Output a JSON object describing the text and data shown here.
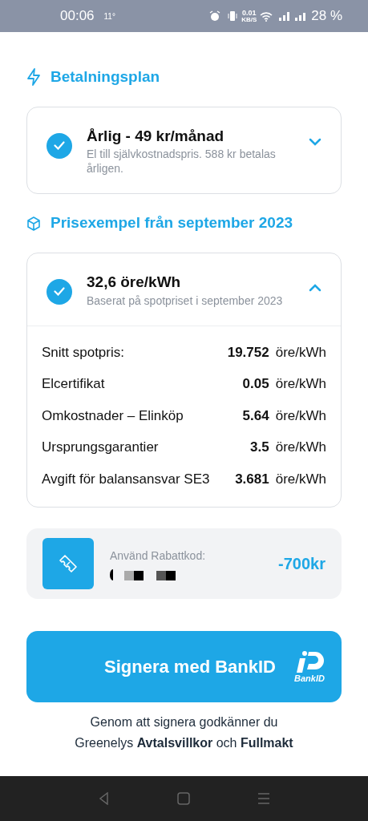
{
  "status_bar": {
    "time": "00:06",
    "temperature": "11°",
    "speed": "0.01",
    "speed_unit": "KB/S",
    "battery": "28 %"
  },
  "sections": [
    {
      "title": "Betalningsplan",
      "kind": "bolt",
      "card": {
        "title": "Årlig - 49 kr/månad",
        "subtitle": "El till självkostnadspris. 588 kr betalas årligen.",
        "checked": true,
        "expanded": false
      }
    },
    {
      "title": "Prisexempel från september 2023",
      "kind": "box",
      "card": {
        "title": "32,6 öre/kWh",
        "subtitle": "Baserat på spotpriset i september 2023",
        "checked": true,
        "expanded": true,
        "rows": [
          {
            "label": "Snitt spotpris:",
            "value": "19.752",
            "unit": "öre/kWh"
          },
          {
            "label": "Elcertifikat",
            "value": "0.05",
            "unit": "öre/kWh"
          },
          {
            "label": "Omkostnader – Elinköp",
            "value": "5.64",
            "unit": "öre/kWh"
          },
          {
            "label": "Ursprungsgarantier",
            "value": "3.5",
            "unit": "öre/kWh"
          },
          {
            "label": "Avgift för balansansvar SE3",
            "value": "3.681",
            "unit": "öre/kWh"
          }
        ]
      }
    }
  ],
  "discount": {
    "label": "Använd Rabattkod:",
    "amount": "-700kr"
  },
  "sign_button": {
    "label": "Signera med BankID",
    "logo_text": "BankID"
  },
  "terms": "Genom att signera godkänner du Greenelys **Avtalsvillkor** och **Fullmakt**"
}
